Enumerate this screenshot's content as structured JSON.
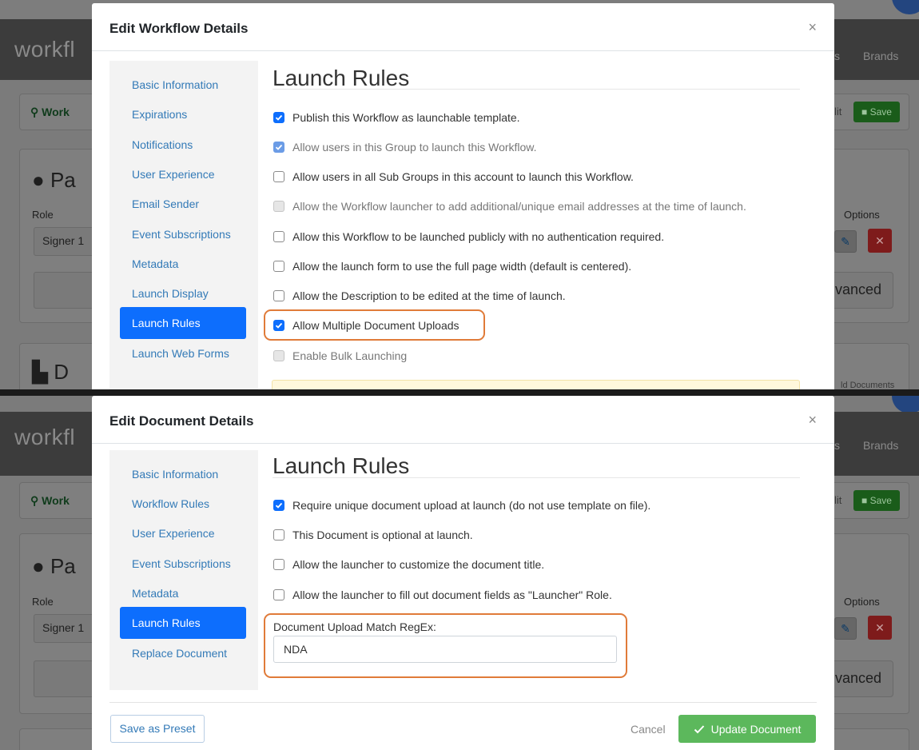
{
  "background_app": {
    "brand": "workfl",
    "nav_link_partial": "s",
    "nav_brands": "Brands",
    "toolbar_workflow_partial": "Work",
    "toolbar_edit_partial": "lit",
    "toolbar_save": "Save",
    "participants_partial": "Pa",
    "role_label": "Role",
    "role_value": "Signer 1",
    "options_label": "Options",
    "advanced_partial": "lvanced",
    "documents_partial": "D",
    "add_documents_partial": "ld Documents"
  },
  "workflow_modal": {
    "title": "Edit Workflow Details",
    "close": "×",
    "nav": [
      {
        "label": "Basic Information"
      },
      {
        "label": "Expirations"
      },
      {
        "label": "Notifications"
      },
      {
        "label": "User Experience"
      },
      {
        "label": "Email Sender"
      },
      {
        "label": "Event Subscriptions"
      },
      {
        "label": "Metadata"
      },
      {
        "label": "Launch Display"
      },
      {
        "label": "Launch Rules",
        "active": true
      },
      {
        "label": "Launch Web Forms"
      }
    ],
    "section_title": "Launch Rules",
    "options": [
      {
        "label": "Publish this Workflow as launchable template.",
        "checked": true,
        "disabled": false
      },
      {
        "label": "Allow users in this Group to launch this Workflow.",
        "checked": true,
        "disabled": true
      },
      {
        "label": "Allow users in all Sub Groups in this account to launch this Workflow.",
        "checked": false,
        "disabled": false
      },
      {
        "label": "Allow the Workflow launcher to add additional/unique email addresses at the time of launch.",
        "checked": false,
        "disabled": true
      },
      {
        "label": "Allow this Workflow to be launched publicly with no authentication required.",
        "checked": false,
        "disabled": false
      },
      {
        "label": "Allow the launch form to use the full page width (default is centered).",
        "checked": false,
        "disabled": false
      },
      {
        "label": "Allow the Description to be edited at the time of launch.",
        "checked": false,
        "disabled": false
      },
      {
        "label": "Allow Multiple Document Uploads",
        "checked": true,
        "disabled": false,
        "highlighted": true
      },
      {
        "label": "Enable Bulk Launching",
        "checked": false,
        "disabled": true
      }
    ]
  },
  "document_modal": {
    "title": "Edit Document Details",
    "close": "×",
    "nav": [
      {
        "label": "Basic Information"
      },
      {
        "label": "Workflow Rules"
      },
      {
        "label": "User Experience"
      },
      {
        "label": "Event Subscriptions"
      },
      {
        "label": "Metadata"
      },
      {
        "label": "Launch Rules",
        "active": true
      },
      {
        "label": "Replace Document"
      }
    ],
    "section_title": "Launch Rules",
    "options": [
      {
        "label": "Require unique document upload at launch (do not use template on file).",
        "checked": true
      },
      {
        "label": "This Document is optional at launch.",
        "checked": false
      },
      {
        "label": "Allow the launcher to customize the document title.",
        "checked": false
      },
      {
        "label": "Allow the launcher to fill out document fields as \"Launcher\" Role.",
        "checked": false
      }
    ],
    "regex_label": "Document Upload Match RegEx:",
    "regex_value": "NDA",
    "footer": {
      "save_preset": "Save as Preset",
      "cancel": "Cancel",
      "update": "Update Document"
    }
  },
  "colors": {
    "primary": "#0d6efd",
    "link": "#337ab7",
    "success": "#5cb85c",
    "highlight": "#e07b39",
    "danger": "#7e1b1b"
  }
}
